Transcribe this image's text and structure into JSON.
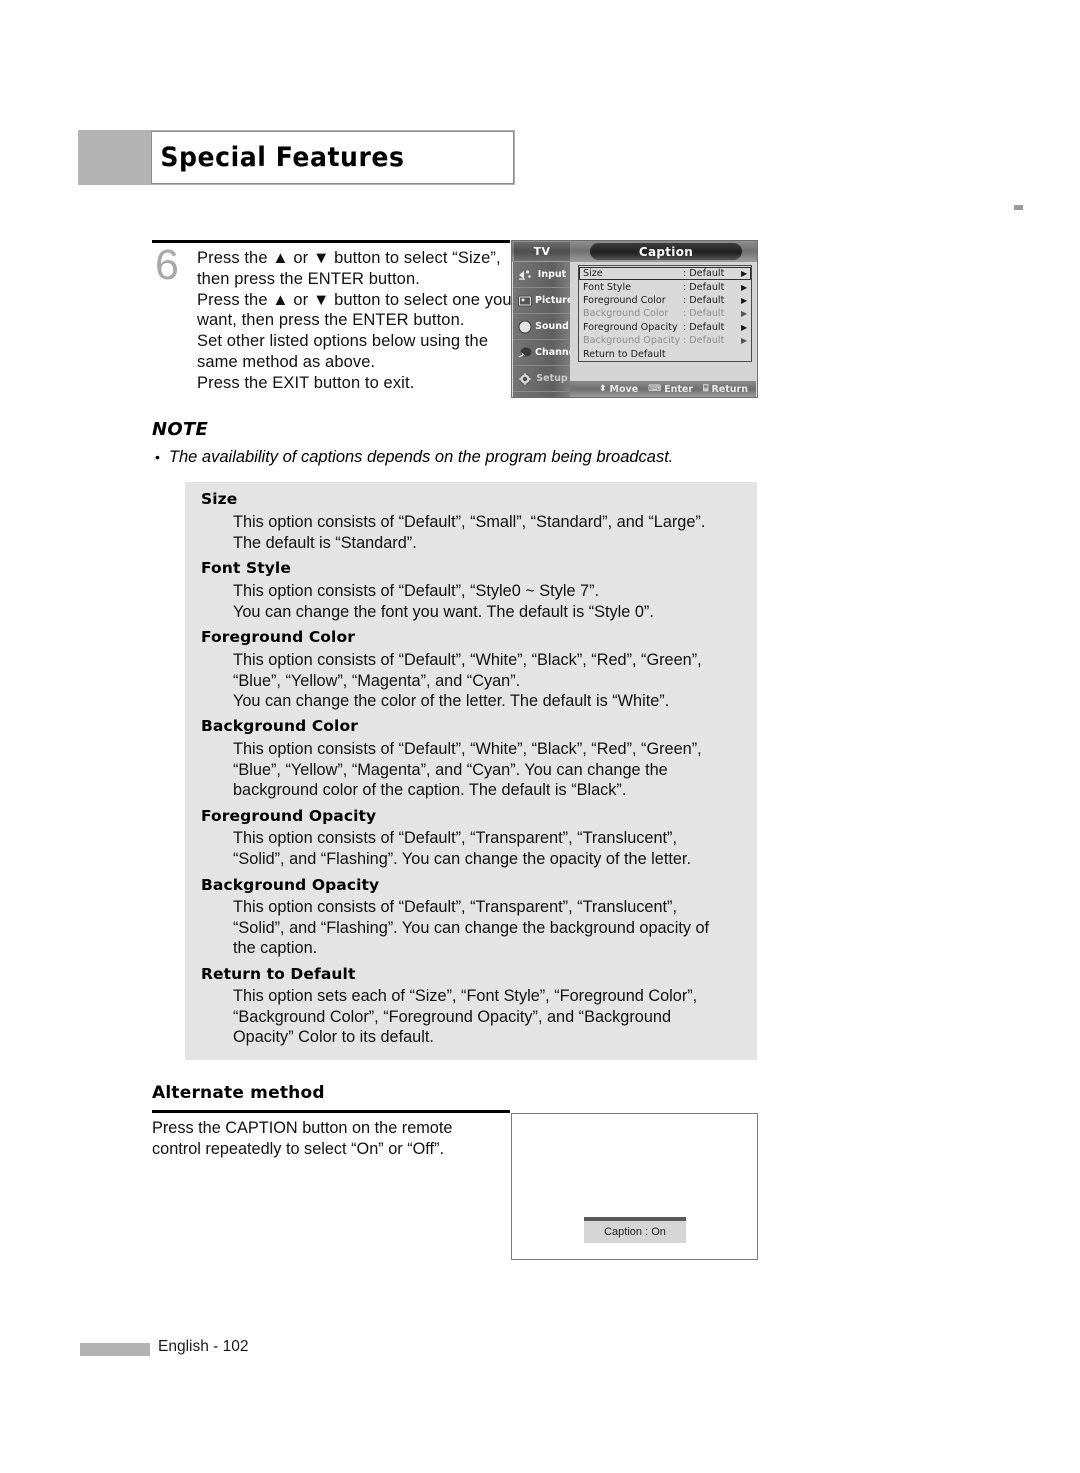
{
  "header": {
    "title": "Special Features"
  },
  "step": {
    "number": "6",
    "lines": [
      "Press the ▲ or ▼ button to select “Size”,",
      "then press the ENTER button.",
      "Press the ▲ or ▼ button to select one you",
      "want, then press the ENTER button.",
      "Set other listed options below using the",
      "same method as above.",
      "Press the EXIT button to exit."
    ]
  },
  "osd": {
    "tv_tab": "TV",
    "title": "Caption",
    "sidebar": [
      {
        "label": "Input",
        "icon": "input-icon"
      },
      {
        "label": "Picture",
        "icon": "picture-icon"
      },
      {
        "label": "Sound",
        "icon": "sound-icon"
      },
      {
        "label": "Channel",
        "icon": "channel-icon"
      },
      {
        "label": "Setup",
        "icon": "setup-icon"
      }
    ],
    "rows": [
      {
        "label": "Size",
        "value": ": Default",
        "arrow": "▶",
        "selected": true,
        "dim": false
      },
      {
        "label": "Font Style",
        "value": ": Default",
        "arrow": "▶",
        "selected": false,
        "dim": false
      },
      {
        "label": "Foreground Color",
        "value": ": Default",
        "arrow": "▶",
        "selected": false,
        "dim": false
      },
      {
        "label": "Background Color",
        "value": ": Default",
        "arrow": "▶",
        "selected": false,
        "dim": true
      },
      {
        "label": "Foreground Opacity",
        "value": ": Default",
        "arrow": "▶",
        "selected": false,
        "dim": false
      },
      {
        "label": "Background Opacity",
        "value": ": Default",
        "arrow": "▶",
        "selected": false,
        "dim": true
      },
      {
        "label": "Return to Default",
        "value": "",
        "arrow": "",
        "selected": false,
        "dim": false
      }
    ],
    "footer": {
      "move_key": "⬍",
      "move_label": "Move",
      "enter_key": "⌨",
      "enter_label": "Enter",
      "return_key": "⌸",
      "return_label": "Return"
    }
  },
  "note": {
    "heading": "NOTE",
    "bullet_marker": "•",
    "bullet_text": "The availability of captions depends on the program being broadcast."
  },
  "options": [
    {
      "title": "Size",
      "lines": [
        "This option consists of “Default”, “Small”, “Standard”, and “Large”.",
        "The default is “Standard”."
      ]
    },
    {
      "title": "Font Style",
      "lines": [
        "This option consists of “Default”, “Style0 ~ Style 7”.",
        "You can change the font you want. The default is “Style 0”."
      ]
    },
    {
      "title": "Foreground Color",
      "lines": [
        "This option consists of “Default”, “White”, “Black”, “Red”, “Green”,",
        "“Blue”, “Yellow”, “Magenta”, and “Cyan”.",
        "You can change the color of the letter. The default is “White”."
      ]
    },
    {
      "title": "Background Color",
      "lines": [
        "This option consists of “Default”, “White”, “Black”, “Red”, “Green”,",
        "“Blue”, “Yellow”, “Magenta”, and “Cyan”. You can change the",
        "background color of the caption. The default is “Black”."
      ]
    },
    {
      "title": "Foreground Opacity",
      "lines": [
        "This option consists of “Default”, “Transparent”, “Translucent”,",
        "“Solid”, and “Flashing”. You can change the opacity of the letter."
      ]
    },
    {
      "title": "Background Opacity",
      "lines": [
        "This option consists of “Default”, “Transparent”, “Translucent”,",
        "“Solid”, and “Flashing”. You can change the background opacity of",
        "the caption."
      ]
    },
    {
      "title": "Return to Default",
      "lines": [
        "This option sets each of “Size”, “Font Style”, “Foreground Color”,",
        "“Background Color”, “Foreground Opacity”, and “Background",
        "Opacity” Color to its default."
      ]
    }
  ],
  "alternate": {
    "heading": "Alternate method",
    "lines": [
      "Press the CAPTION button on the remote",
      "control repeatedly to select “On” or “Off”."
    ],
    "caption_osd": "Caption : On"
  },
  "footer": {
    "text": "English - 102"
  },
  "colors": {
    "header_bar": "#b3b3b3",
    "options_box": "#e4e4e4",
    "osd_panel": "#d4d4d4"
  }
}
